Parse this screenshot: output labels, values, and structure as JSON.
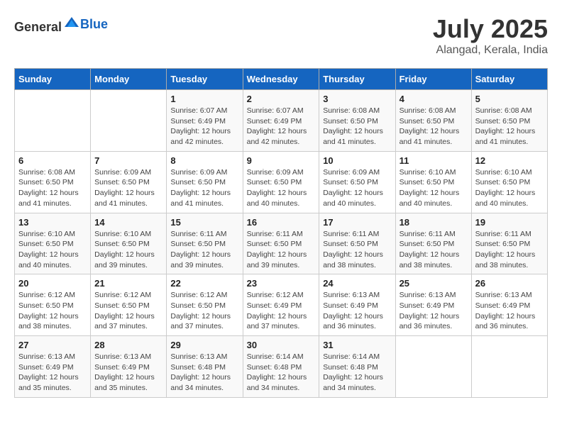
{
  "logo": {
    "general": "General",
    "blue": "Blue"
  },
  "title": "July 2025",
  "subtitle": "Alangad, Kerala, India",
  "days_header": [
    "Sunday",
    "Monday",
    "Tuesday",
    "Wednesday",
    "Thursday",
    "Friday",
    "Saturday"
  ],
  "weeks": [
    [
      {
        "day": "",
        "info": ""
      },
      {
        "day": "",
        "info": ""
      },
      {
        "day": "1",
        "info": "Sunrise: 6:07 AM\nSunset: 6:49 PM\nDaylight: 12 hours and 42 minutes."
      },
      {
        "day": "2",
        "info": "Sunrise: 6:07 AM\nSunset: 6:49 PM\nDaylight: 12 hours and 42 minutes."
      },
      {
        "day": "3",
        "info": "Sunrise: 6:08 AM\nSunset: 6:50 PM\nDaylight: 12 hours and 41 minutes."
      },
      {
        "day": "4",
        "info": "Sunrise: 6:08 AM\nSunset: 6:50 PM\nDaylight: 12 hours and 41 minutes."
      },
      {
        "day": "5",
        "info": "Sunrise: 6:08 AM\nSunset: 6:50 PM\nDaylight: 12 hours and 41 minutes."
      }
    ],
    [
      {
        "day": "6",
        "info": "Sunrise: 6:08 AM\nSunset: 6:50 PM\nDaylight: 12 hours and 41 minutes."
      },
      {
        "day": "7",
        "info": "Sunrise: 6:09 AM\nSunset: 6:50 PM\nDaylight: 12 hours and 41 minutes."
      },
      {
        "day": "8",
        "info": "Sunrise: 6:09 AM\nSunset: 6:50 PM\nDaylight: 12 hours and 41 minutes."
      },
      {
        "day": "9",
        "info": "Sunrise: 6:09 AM\nSunset: 6:50 PM\nDaylight: 12 hours and 40 minutes."
      },
      {
        "day": "10",
        "info": "Sunrise: 6:09 AM\nSunset: 6:50 PM\nDaylight: 12 hours and 40 minutes."
      },
      {
        "day": "11",
        "info": "Sunrise: 6:10 AM\nSunset: 6:50 PM\nDaylight: 12 hours and 40 minutes."
      },
      {
        "day": "12",
        "info": "Sunrise: 6:10 AM\nSunset: 6:50 PM\nDaylight: 12 hours and 40 minutes."
      }
    ],
    [
      {
        "day": "13",
        "info": "Sunrise: 6:10 AM\nSunset: 6:50 PM\nDaylight: 12 hours and 40 minutes."
      },
      {
        "day": "14",
        "info": "Sunrise: 6:10 AM\nSunset: 6:50 PM\nDaylight: 12 hours and 39 minutes."
      },
      {
        "day": "15",
        "info": "Sunrise: 6:11 AM\nSunset: 6:50 PM\nDaylight: 12 hours and 39 minutes."
      },
      {
        "day": "16",
        "info": "Sunrise: 6:11 AM\nSunset: 6:50 PM\nDaylight: 12 hours and 39 minutes."
      },
      {
        "day": "17",
        "info": "Sunrise: 6:11 AM\nSunset: 6:50 PM\nDaylight: 12 hours and 38 minutes."
      },
      {
        "day": "18",
        "info": "Sunrise: 6:11 AM\nSunset: 6:50 PM\nDaylight: 12 hours and 38 minutes."
      },
      {
        "day": "19",
        "info": "Sunrise: 6:11 AM\nSunset: 6:50 PM\nDaylight: 12 hours and 38 minutes."
      }
    ],
    [
      {
        "day": "20",
        "info": "Sunrise: 6:12 AM\nSunset: 6:50 PM\nDaylight: 12 hours and 38 minutes."
      },
      {
        "day": "21",
        "info": "Sunrise: 6:12 AM\nSunset: 6:50 PM\nDaylight: 12 hours and 37 minutes."
      },
      {
        "day": "22",
        "info": "Sunrise: 6:12 AM\nSunset: 6:50 PM\nDaylight: 12 hours and 37 minutes."
      },
      {
        "day": "23",
        "info": "Sunrise: 6:12 AM\nSunset: 6:49 PM\nDaylight: 12 hours and 37 minutes."
      },
      {
        "day": "24",
        "info": "Sunrise: 6:13 AM\nSunset: 6:49 PM\nDaylight: 12 hours and 36 minutes."
      },
      {
        "day": "25",
        "info": "Sunrise: 6:13 AM\nSunset: 6:49 PM\nDaylight: 12 hours and 36 minutes."
      },
      {
        "day": "26",
        "info": "Sunrise: 6:13 AM\nSunset: 6:49 PM\nDaylight: 12 hours and 36 minutes."
      }
    ],
    [
      {
        "day": "27",
        "info": "Sunrise: 6:13 AM\nSunset: 6:49 PM\nDaylight: 12 hours and 35 minutes."
      },
      {
        "day": "28",
        "info": "Sunrise: 6:13 AM\nSunset: 6:49 PM\nDaylight: 12 hours and 35 minutes."
      },
      {
        "day": "29",
        "info": "Sunrise: 6:13 AM\nSunset: 6:48 PM\nDaylight: 12 hours and 34 minutes."
      },
      {
        "day": "30",
        "info": "Sunrise: 6:14 AM\nSunset: 6:48 PM\nDaylight: 12 hours and 34 minutes."
      },
      {
        "day": "31",
        "info": "Sunrise: 6:14 AM\nSunset: 6:48 PM\nDaylight: 12 hours and 34 minutes."
      },
      {
        "day": "",
        "info": ""
      },
      {
        "day": "",
        "info": ""
      }
    ]
  ]
}
